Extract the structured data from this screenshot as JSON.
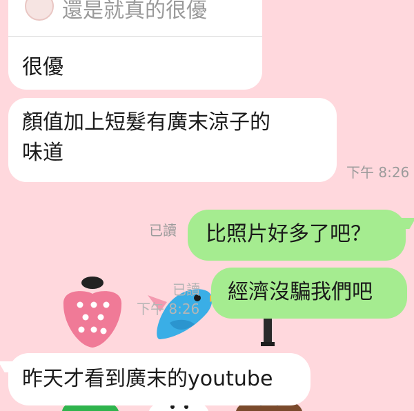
{
  "messages": [
    {
      "side": "incoming",
      "quoted": {
        "text": "還是就真的很優"
      },
      "text": "很優"
    },
    {
      "side": "incoming",
      "lines": [
        "顏值加上短髮有廣末涼子的",
        "味道"
      ],
      "time": "下午 8:26"
    },
    {
      "side": "outgoing",
      "text": "比照片好多了吧？",
      "status": "已讀"
    },
    {
      "side": "outgoing",
      "text": "經濟沒騙我們吧",
      "status": "已讀",
      "time": "下午 8:26"
    },
    {
      "side": "incoming",
      "text": "昨天才看到廣末的youtube"
    }
  ],
  "colors": {
    "background": "#ffd8dd",
    "incoming_bubble": "#ffffff",
    "outgoing_bubble": "#a5ec90",
    "meta_text": "#9b9b9b"
  },
  "icons": {
    "quote_avatar": "avatar",
    "sticker_strawberry": "strawberry-sticker-icon",
    "sticker_bird": "bird-sticker-icon",
    "sticker_tree": "tree-sticker-icon",
    "sticker_bottom": "character-stickers-icon"
  }
}
